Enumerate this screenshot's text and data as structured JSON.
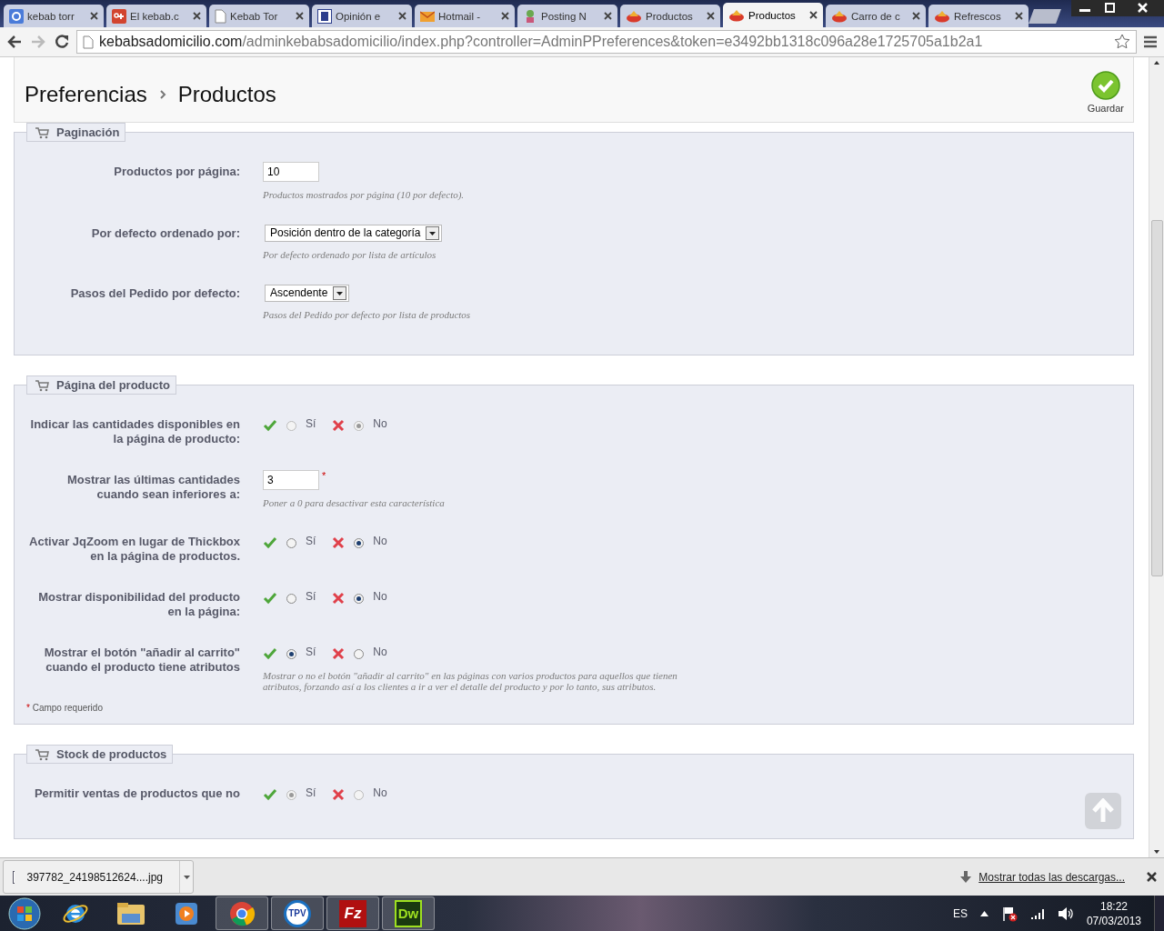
{
  "browser": {
    "tabs": [
      {
        "title": "kebab torr",
        "selected": false
      },
      {
        "title": "El kebab.c",
        "selected": false
      },
      {
        "title": "Kebab Tor",
        "selected": false
      },
      {
        "title": "Opinión e",
        "selected": false
      },
      {
        "title": "Hotmail -",
        "selected": false
      },
      {
        "title": "Posting N",
        "selected": false
      },
      {
        "title": "Productos",
        "selected": false
      },
      {
        "title": "Productos",
        "selected": true
      },
      {
        "title": "Carro de c",
        "selected": false
      },
      {
        "title": "Refrescos",
        "selected": false
      }
    ],
    "url_domain": "kebabsadomicilio.com",
    "url_path": "/adminkebabsadomicilio/index.php?controller=AdminPPreferences&token=e3492bb1318c096a28e1725705a1b2a1"
  },
  "page_header": {
    "breadcrumb": [
      "Preferencias",
      "Productos"
    ],
    "save_label": "Guardar"
  },
  "sections": [
    {
      "title": "Paginación",
      "fields": [
        {
          "kind": "text",
          "label": "Productos por página:",
          "value": "10",
          "help": "Productos mostrados por página (10 por defecto)."
        },
        {
          "kind": "select",
          "label": "Por defecto ordenado por:",
          "value": "Posición dentro de la categoría",
          "help": "Por defecto ordenado por lista de artículos"
        },
        {
          "kind": "select",
          "label": "Pasos del Pedido por defecto:",
          "value": "Ascendente",
          "help": "Pasos del Pedido por defecto por lista de productos"
        }
      ]
    },
    {
      "title": "Página del producto",
      "fields": [
        {
          "kind": "radio",
          "label": "Indicar las cantidades disponibles en la página de producto:",
          "disabled": true,
          "options": [
            {
              "label": "Sí",
              "selected": false
            },
            {
              "label": "No",
              "selected": true
            }
          ]
        },
        {
          "kind": "text",
          "label": "Mostrar las últimas cantidades cuando sean inferiores a:",
          "value": "3",
          "required_mark": "*",
          "help": "Poner a 0 para desactivar esta característica"
        },
        {
          "kind": "radio",
          "label": "Activar JqZoom en lugar de Thickbox en la página de productos.",
          "disabled": false,
          "options": [
            {
              "label": "Sí",
              "selected": false
            },
            {
              "label": "No",
              "selected": true
            }
          ]
        },
        {
          "kind": "radio",
          "label": "Mostrar disponibilidad del producto en la página:",
          "disabled": false,
          "options": [
            {
              "label": "Sí",
              "selected": false
            },
            {
              "label": "No",
              "selected": true
            }
          ]
        },
        {
          "kind": "radio",
          "label": "Mostrar el botón \"añadir al carrito\" cuando el producto tiene atributos",
          "disabled": false,
          "options": [
            {
              "label": "Sí",
              "selected": true
            },
            {
              "label": "No",
              "selected": false
            }
          ],
          "help": "Mostrar o no el botón \"añadir al carrito\" en las páginas con varios productos para aquellos que tienen atributos, forzando así a los clientes a ir a ver el detalle del producto y por lo tanto, sus atributos."
        }
      ],
      "footnote": {
        "mark": "*",
        "text": "Campo requerido"
      }
    },
    {
      "title": "Stock de productos",
      "fields": [
        {
          "kind": "radio",
          "label": "Permitir ventas de productos que no",
          "disabled": true,
          "options": [
            {
              "label": "Sí",
              "selected": true
            },
            {
              "label": "No",
              "selected": false
            }
          ]
        }
      ]
    }
  ],
  "download_bar": {
    "file": "397782_24198512624....jpg",
    "show_all": "Mostrar todas las descargas..."
  },
  "taskbar": {
    "apps": [
      {
        "kind": "ie",
        "running": false
      },
      {
        "kind": "explorer",
        "running": false
      },
      {
        "kind": "media",
        "running": false
      },
      {
        "kind": "chrome",
        "running": true
      },
      {
        "kind": "badge",
        "text": "TPV",
        "running": true
      },
      {
        "kind": "filezilla",
        "text": "Fz",
        "running": true
      },
      {
        "kind": "dreamweaver",
        "text": "Dw",
        "running": true
      }
    ],
    "language": "ES",
    "time": "18:22",
    "date": "07/03/2013"
  }
}
